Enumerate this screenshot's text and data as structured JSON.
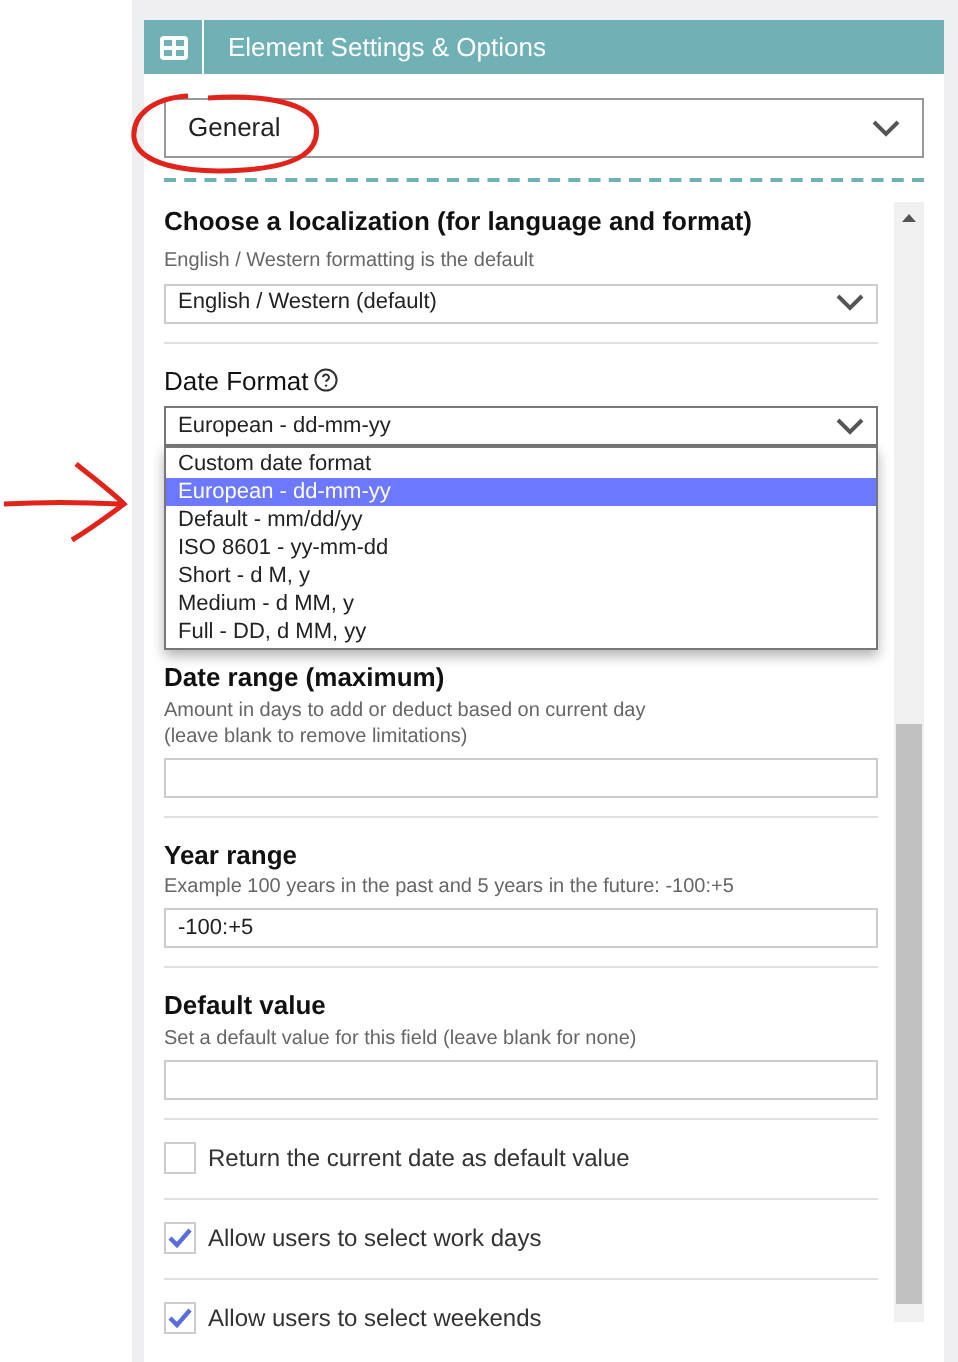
{
  "header": {
    "title": "Element Settings & Options"
  },
  "tab_select": {
    "value": "General"
  },
  "localization": {
    "label": "Choose a localization (for language and format)",
    "hint": "English / Western formatting is the default",
    "value": "English / Western (default)"
  },
  "date_format": {
    "label": "Date Format",
    "value": "European - dd-mm-yy",
    "expanded": true,
    "options": [
      {
        "label": "Custom date format",
        "selected": false
      },
      {
        "label": "European - dd-mm-yy",
        "selected": true
      },
      {
        "label": "Default - mm/dd/yy",
        "selected": false
      },
      {
        "label": "ISO 8601 - yy-mm-dd",
        "selected": false
      },
      {
        "label": "Short - d M, y",
        "selected": false
      },
      {
        "label": "Medium - d MM, y",
        "selected": false
      },
      {
        "label": "Full - DD, d MM, yy",
        "selected": false
      }
    ]
  },
  "fields": [
    {
      "label": "Date range (maximum)",
      "hints": [
        "Amount in days to add or deduct based on current day",
        "(leave blank to remove limitations)"
      ]
    },
    {
      "label": "Year range",
      "hints": [
        "Example 100 years in the past and 5 years in the future: -100:+5"
      ],
      "value": "-100:+5"
    },
    {
      "label": "Default value",
      "hints": [
        "Set a default value for this field (leave blank for none)"
      ]
    }
  ],
  "checkboxes": [
    {
      "label": "Return the current date as default value",
      "checked": false
    },
    {
      "label": "Allow users to select work days",
      "checked": true
    },
    {
      "label": "Allow users to select weekends",
      "checked": true
    }
  ]
}
